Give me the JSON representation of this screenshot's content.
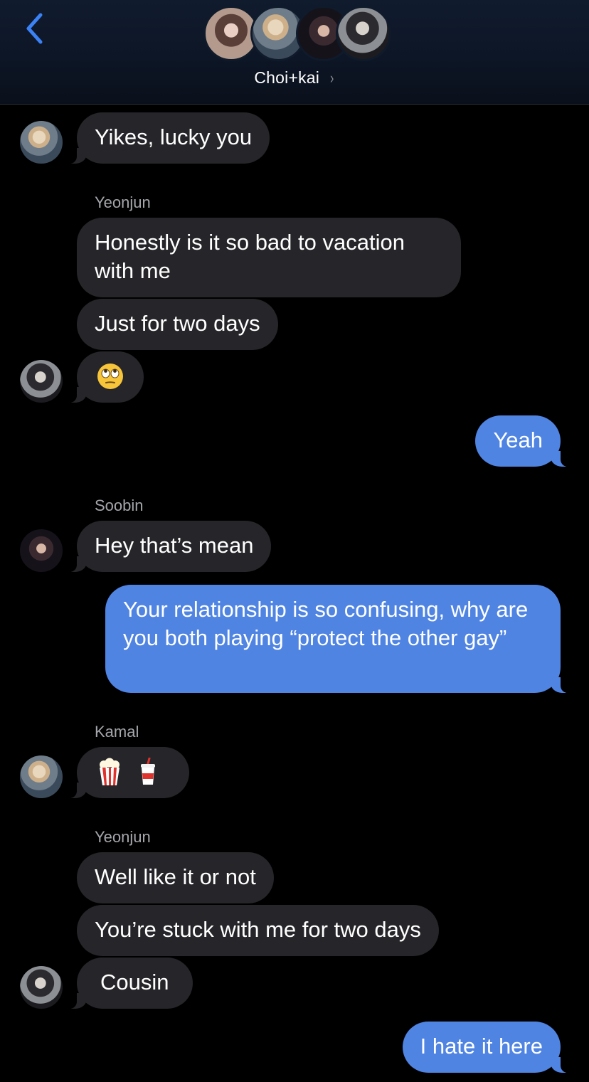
{
  "header": {
    "group_name": "Choi+kai",
    "chevron": "›",
    "back_icon": "chevron-left-icon",
    "accent_color": "#3b82f6"
  },
  "colors": {
    "incoming_bubble": "#26262a",
    "outgoing_bubble": "#4f84e3",
    "sender_label": "#a5a6ab",
    "background": "#000000"
  },
  "messages": [
    {
      "direction": "incoming",
      "text": "Yikes, lucky you",
      "avatar": "avatar-blond"
    },
    {
      "direction": "incoming",
      "sender": "Yeonjun",
      "text": "Honestly is it so bad to vacation with me"
    },
    {
      "direction": "incoming",
      "text": "Just for two days"
    },
    {
      "direction": "incoming",
      "text": "eye-roll-emoji",
      "avatar": "avatar-black-white"
    },
    {
      "direction": "outgoing",
      "text": "Yeah"
    },
    {
      "direction": "incoming",
      "sender": "Soobin",
      "text": "Hey that’s mean",
      "avatar": "avatar-dark"
    },
    {
      "direction": "outgoing",
      "text": "Your relationship is so confusing, why are you both playing “protect the other gay”"
    },
    {
      "direction": "incoming",
      "sender": "Kamal",
      "text": "popcorn-emoji cup-with-straw-emoji",
      "avatar": "avatar-blond"
    },
    {
      "direction": "incoming",
      "sender": "Yeonjun",
      "text": "Well like it or not"
    },
    {
      "direction": "incoming",
      "text": "You’re stuck with me for two days"
    },
    {
      "direction": "incoming",
      "text": "Cousin",
      "avatar": "avatar-black-white"
    },
    {
      "direction": "outgoing",
      "text": "I hate it here"
    }
  ]
}
